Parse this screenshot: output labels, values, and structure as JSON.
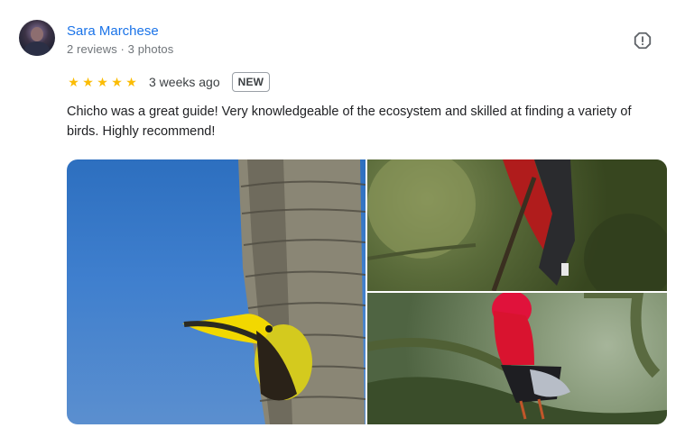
{
  "review": {
    "author_name": "Sara Marchese",
    "author_meta": "2 reviews · 3 photos",
    "rating": 5,
    "stars": [
      "★",
      "★",
      "★",
      "★",
      "★"
    ],
    "time_ago": "3 weeks ago",
    "badge": "NEW",
    "text": "Chicho was a great guide! Very knowledgeable of the ecosystem and skilled at finding a variety of birds. Highly recommend!"
  },
  "icons": {
    "report": "report-flag-icon"
  },
  "colors": {
    "author_link": "#1a73e8",
    "star": "#fbbc04",
    "meta_text": "#70757a"
  },
  "photos": [
    {
      "subject": "yellow-throated toucan on palm trunk"
    },
    {
      "subject": "red trogon on branch"
    },
    {
      "subject": "andean cock-of-the-rock on branch"
    }
  ]
}
